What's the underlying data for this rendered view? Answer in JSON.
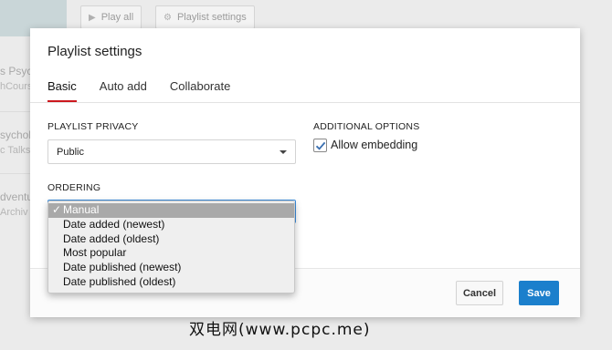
{
  "background": {
    "buttons": [
      {
        "icon": "play-icon",
        "label": "Play all"
      },
      {
        "icon": "gear-icon",
        "label": "Playlist settings"
      }
    ],
    "rows": [
      {
        "title": "s Psych",
        "subtitle": "hCours"
      },
      {
        "title": "sycholo",
        "subtitle": "c Talks"
      },
      {
        "title": "dventu",
        "subtitle": "Archiv"
      }
    ]
  },
  "dialog": {
    "title": "Playlist settings",
    "tabs": [
      {
        "label": "Basic",
        "active": true
      },
      {
        "label": "Auto add",
        "active": false
      },
      {
        "label": "Collaborate",
        "active": false
      }
    ],
    "privacy": {
      "label": "PLAYLIST PRIVACY",
      "value": "Public"
    },
    "additional": {
      "label": "ADDITIONAL OPTIONS",
      "allow_embedding_label": "Allow embedding",
      "allow_embedding_checked": true
    },
    "ordering": {
      "label": "ORDERING",
      "selected": "Manual",
      "options": [
        "Manual",
        "Date added (newest)",
        "Date added (oldest)",
        "Most popular",
        "Date published (newest)",
        "Date published (oldest)"
      ]
    },
    "footer": {
      "cancel_label": "Cancel",
      "save_label": "Save"
    }
  },
  "watermark": "双电网(www.pcpc.me)",
  "colors": {
    "accent_tab": "#cc181e",
    "save_button": "#1b7fcc",
    "focus_border": "#3b8ddd"
  }
}
